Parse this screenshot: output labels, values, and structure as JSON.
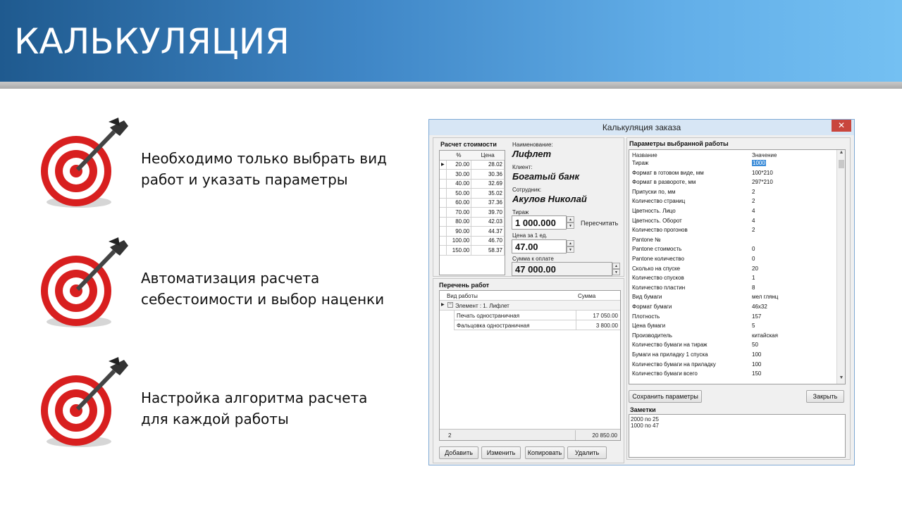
{
  "slide": {
    "title": "КАЛЬКУЛЯЦИЯ",
    "bullets": [
      {
        "text": "Необходимо только выбрать вид\nработ и указать параметры"
      },
      {
        "text": "Автоматизация расчета\nсебестоимости и выбор наценки"
      },
      {
        "text": "Настройка алгоритма расчета\nдля каждой работы"
      }
    ]
  },
  "window": {
    "title": "Калькуляция заказа",
    "close": "✕",
    "cost": {
      "title": "Расчет стоимости",
      "col_percent": "%",
      "col_price": "Цена",
      "rows": [
        {
          "p": "20.00",
          "v": "28.02"
        },
        {
          "p": "30.00",
          "v": "30.36"
        },
        {
          "p": "40.00",
          "v": "32.69"
        },
        {
          "p": "50.00",
          "v": "35.02"
        },
        {
          "p": "60.00",
          "v": "37.36"
        },
        {
          "p": "70.00",
          "v": "39.70"
        },
        {
          "p": "80.00",
          "v": "42.03"
        },
        {
          "p": "90.00",
          "v": "44.37"
        },
        {
          "p": "100.00",
          "v": "46.70"
        },
        {
          "p": "150.00",
          "v": "58.37"
        }
      ],
      "name_label": "Наименование:",
      "name_value": "Лифлет",
      "client_label": "Клиент:",
      "client_value": "Богатый банк",
      "employee_label": "Сотрудник:",
      "employee_value": "Акулов Николай",
      "run_label": "Тираж",
      "run_value": "1 000.000",
      "recalc": "Пересчитать",
      "unit_price_label": "Цена за 1 ед.",
      "unit_price_value": "47.00",
      "total_label": "Сумма к оплате",
      "total_value": "47 000.00"
    },
    "works": {
      "title": "Перечень работ",
      "col_type": "Вид работы",
      "col_sum": "Сумма",
      "group": "Элемент : 1. Лифлет",
      "rows": [
        {
          "name": "Печать одностраничная",
          "sum": "17 050.00"
        },
        {
          "name": "Фальцовка одностраничная",
          "sum": "3 800.00"
        }
      ],
      "footer_count": "2",
      "footer_sum": "20 850.00",
      "buttons": {
        "add": "Добавить",
        "edit": "Изменить",
        "copy": "Копировать",
        "delete": "Удалить"
      }
    },
    "params": {
      "title": "Параметры выбранной работы",
      "col_name": "Название",
      "col_value": "Значение",
      "rows": [
        {
          "n": "Тираж",
          "v": "1000"
        },
        {
          "n": "Формат в готовом виде, мм",
          "v": "100*210"
        },
        {
          "n": "Формат в развороте, мм",
          "v": "297*210"
        },
        {
          "n": "Припуски по, мм",
          "v": "2"
        },
        {
          "n": "Количество страниц",
          "v": "2"
        },
        {
          "n": "Цветность. Лицо",
          "v": "4"
        },
        {
          "n": "Цветность. Оборот",
          "v": "4"
        },
        {
          "n": "Количество прогонов",
          "v": "2"
        },
        {
          "n": "Pantone №",
          "v": ""
        },
        {
          "n": "Pantone стоимость",
          "v": "0"
        },
        {
          "n": "Pantone количество",
          "v": "0"
        },
        {
          "n": "Сколько на спуске",
          "v": "20"
        },
        {
          "n": "Количество спусков",
          "v": "1"
        },
        {
          "n": "Количество пластин",
          "v": "8"
        },
        {
          "n": "Вид бумаги",
          "v": "мел глянц"
        },
        {
          "n": "Формат бумаги",
          "v": "46x32"
        },
        {
          "n": "Плотность",
          "v": "157"
        },
        {
          "n": "Цена бумаги",
          "v": "5"
        },
        {
          "n": "Производитель",
          "v": "китайская"
        },
        {
          "n": "Количество бумаги на тираж",
          "v": "50"
        },
        {
          "n": "Бумаги на приладку 1 спуска",
          "v": "100"
        },
        {
          "n": "Количество бумаги на приладку",
          "v": "100"
        },
        {
          "n": "Количество бумаги всего",
          "v": "150"
        }
      ],
      "save": "Сохранить параметры",
      "close": "Закрыть"
    },
    "notes": {
      "title": "Заметки",
      "line1": "2000 по 25",
      "line2": "1000 по 47"
    }
  }
}
